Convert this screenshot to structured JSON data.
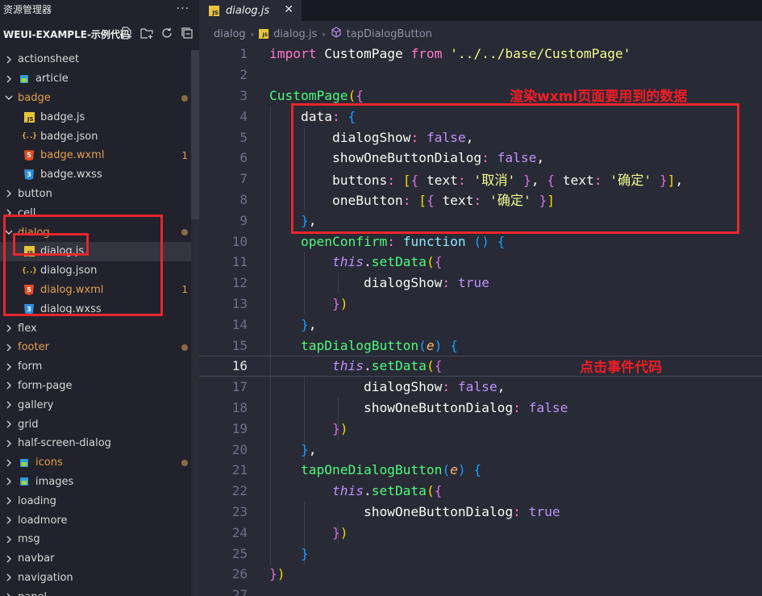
{
  "sidebar": {
    "title": "资源管理器",
    "more": "···",
    "project": "WEUI-EXAMPLE-示例代码",
    "tree": [
      {
        "label": "actionsheet",
        "type": "folder",
        "level": 0
      },
      {
        "label": "article",
        "type": "folder-special",
        "level": 0
      },
      {
        "label": "badge",
        "type": "folder-open",
        "level": 0,
        "modified": true,
        "dot": true
      },
      {
        "label": "badge.js",
        "type": "js",
        "level": 1
      },
      {
        "label": "badge.json",
        "type": "json",
        "level": 1
      },
      {
        "label": "badge.wxml",
        "type": "html",
        "level": 1,
        "modified": true,
        "count": "1"
      },
      {
        "label": "badge.wxss",
        "type": "css",
        "level": 1
      },
      {
        "label": "button",
        "type": "folder",
        "level": 0
      },
      {
        "label": "cell",
        "type": "folder",
        "level": 0
      },
      {
        "label": "dialog",
        "type": "folder-open",
        "level": 0,
        "modified": true,
        "dot": true
      },
      {
        "label": "dialog.js",
        "type": "js",
        "level": 1,
        "selected": true
      },
      {
        "label": "dialog.json",
        "type": "json",
        "level": 1
      },
      {
        "label": "dialog.wxml",
        "type": "html",
        "level": 1,
        "modified": true,
        "count": "1"
      },
      {
        "label": "dialog.wxss",
        "type": "css",
        "level": 1
      },
      {
        "label": "flex",
        "type": "folder",
        "level": 0
      },
      {
        "label": "footer",
        "type": "folder",
        "level": 0,
        "modified": true,
        "dot": true
      },
      {
        "label": "form",
        "type": "folder",
        "level": 0
      },
      {
        "label": "form-page",
        "type": "folder",
        "level": 0
      },
      {
        "label": "gallery",
        "type": "folder",
        "level": 0
      },
      {
        "label": "grid",
        "type": "folder",
        "level": 0
      },
      {
        "label": "half-screen-dialog",
        "type": "folder",
        "level": 0
      },
      {
        "label": "icons",
        "type": "folder-special",
        "level": 0,
        "modified": true,
        "dot": true
      },
      {
        "label": "images",
        "type": "folder-special",
        "level": 0
      },
      {
        "label": "loading",
        "type": "folder",
        "level": 0
      },
      {
        "label": "loadmore",
        "type": "folder",
        "level": 0
      },
      {
        "label": "msg",
        "type": "folder",
        "level": 0
      },
      {
        "label": "navbar",
        "type": "folder",
        "level": 0
      },
      {
        "label": "navigation",
        "type": "folder",
        "level": 0
      },
      {
        "label": "panel",
        "type": "folder",
        "level": 0
      }
    ]
  },
  "editor": {
    "tab": {
      "label": "dialog.js",
      "close": "✕"
    },
    "breadcrumb": [
      "dialog",
      "dialog.js",
      "tapDialogButton"
    ],
    "current_line": 16,
    "lines": [
      {
        "n": "1",
        "t": [
          [
            "kw",
            "import "
          ],
          [
            "pl",
            "CustomPage "
          ],
          [
            "kw",
            "from "
          ],
          [
            "str",
            "'../../base/CustomPage'"
          ]
        ]
      },
      {
        "n": "2",
        "t": []
      },
      {
        "n": "3",
        "t": [
          [
            "fn",
            "CustomPage"
          ],
          [
            "br1",
            "("
          ],
          [
            "br2",
            "{"
          ]
        ]
      },
      {
        "n": "4",
        "t": [
          [
            "pl",
            "    data"
          ],
          [
            "kw",
            ": "
          ],
          [
            "br3",
            "{"
          ]
        ]
      },
      {
        "n": "5",
        "t": [
          [
            "pl",
            "        dialogShow"
          ],
          [
            "kw",
            ": "
          ],
          [
            "bool",
            "false"
          ],
          [
            "pl",
            ","
          ]
        ]
      },
      {
        "n": "6",
        "t": [
          [
            "pl",
            "        showOneButtonDialog"
          ],
          [
            "kw",
            ": "
          ],
          [
            "bool",
            "false"
          ],
          [
            "pl",
            ","
          ]
        ]
      },
      {
        "n": "7",
        "t": [
          [
            "pl",
            "        buttons"
          ],
          [
            "kw",
            ": "
          ],
          [
            "br1",
            "["
          ],
          [
            "br2",
            "{ "
          ],
          [
            "pl",
            "text"
          ],
          [
            "kw",
            ": "
          ],
          [
            "str",
            "'取消' "
          ],
          [
            "br2",
            "}"
          ],
          [
            "pl",
            ", "
          ],
          [
            "br2",
            "{ "
          ],
          [
            "pl",
            "text"
          ],
          [
            "kw",
            ": "
          ],
          [
            "str",
            "'确定' "
          ],
          [
            "br2",
            "}"
          ],
          [
            "br1",
            "]"
          ],
          [
            "pl",
            ","
          ]
        ]
      },
      {
        "n": "8",
        "t": [
          [
            "pl",
            "        oneButton"
          ],
          [
            "kw",
            ": "
          ],
          [
            "br1",
            "["
          ],
          [
            "br2",
            "{ "
          ],
          [
            "pl",
            "text"
          ],
          [
            "kw",
            ": "
          ],
          [
            "str",
            "'确定' "
          ],
          [
            "br2",
            "}"
          ],
          [
            "br1",
            "]"
          ]
        ]
      },
      {
        "n": "9",
        "t": [
          [
            "br3",
            "    }"
          ],
          [
            "pl",
            ","
          ]
        ]
      },
      {
        "n": "10",
        "t": [
          [
            "fn",
            "    openConfirm"
          ],
          [
            "kw",
            ": "
          ],
          [
            "fnkw",
            "function "
          ],
          [
            "br3",
            "() {"
          ]
        ]
      },
      {
        "n": "11",
        "t": [
          [
            "this",
            "        this"
          ],
          [
            "pl",
            "."
          ],
          [
            "fn",
            "setData"
          ],
          [
            "br1",
            "("
          ],
          [
            "br2",
            "{"
          ]
        ]
      },
      {
        "n": "12",
        "t": [
          [
            "pl",
            "            dialogShow"
          ],
          [
            "kw",
            ": "
          ],
          [
            "bool",
            "true"
          ]
        ]
      },
      {
        "n": "13",
        "t": [
          [
            "br2",
            "        }"
          ],
          [
            "br1",
            ")"
          ]
        ]
      },
      {
        "n": "14",
        "t": [
          [
            "br3",
            "    }"
          ],
          [
            "pl",
            ","
          ]
        ]
      },
      {
        "n": "15",
        "t": [
          [
            "fn",
            "    tapDialogButton"
          ],
          [
            "br3",
            "("
          ],
          [
            "param",
            "e"
          ],
          [
            "br3",
            ") {"
          ]
        ]
      },
      {
        "n": "16",
        "t": [
          [
            "this",
            "        this"
          ],
          [
            "pl",
            "."
          ],
          [
            "fn",
            "setData"
          ],
          [
            "br1",
            "("
          ],
          [
            "br2",
            "{"
          ]
        ]
      },
      {
        "n": "17",
        "t": [
          [
            "pl",
            "            dialogShow"
          ],
          [
            "kw",
            ": "
          ],
          [
            "bool",
            "false"
          ],
          [
            "pl",
            ","
          ]
        ]
      },
      {
        "n": "18",
        "t": [
          [
            "pl",
            "            showOneButtonDialog"
          ],
          [
            "kw",
            ": "
          ],
          [
            "bool",
            "false"
          ]
        ]
      },
      {
        "n": "19",
        "t": [
          [
            "br2",
            "        }"
          ],
          [
            "br1",
            ")"
          ]
        ]
      },
      {
        "n": "20",
        "t": [
          [
            "br3",
            "    }"
          ],
          [
            "pl",
            ","
          ]
        ]
      },
      {
        "n": "21",
        "t": [
          [
            "fn",
            "    tapOneDialogButton"
          ],
          [
            "br3",
            "("
          ],
          [
            "param",
            "e"
          ],
          [
            "br3",
            ") {"
          ]
        ]
      },
      {
        "n": "22",
        "t": [
          [
            "this",
            "        this"
          ],
          [
            "pl",
            "."
          ],
          [
            "fn",
            "setData"
          ],
          [
            "br1",
            "("
          ],
          [
            "br2",
            "{"
          ]
        ]
      },
      {
        "n": "23",
        "t": [
          [
            "pl",
            "            showOneButtonDialog"
          ],
          [
            "kw",
            ": "
          ],
          [
            "bool",
            "true"
          ]
        ]
      },
      {
        "n": "24",
        "t": [
          [
            "br2",
            "        }"
          ],
          [
            "br1",
            ")"
          ]
        ]
      },
      {
        "n": "25",
        "t": [
          [
            "br3",
            "    }"
          ]
        ]
      },
      {
        "n": "26",
        "t": [
          [
            "br2",
            "}"
          ],
          [
            "br1",
            ")"
          ]
        ]
      },
      {
        "n": "27",
        "t": []
      }
    ]
  },
  "annotations": {
    "data_note": "渲染wxml页面要用到的数据",
    "click_note": "点击事件代码"
  },
  "colors": {
    "annotation_red": "#e8262b",
    "modified_orange": "#e2a050"
  }
}
